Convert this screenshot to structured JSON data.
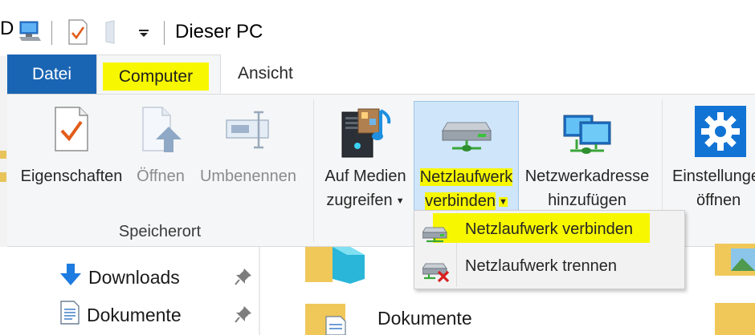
{
  "window": {
    "title": "Dieser PC",
    "partial_left_glyph": "D"
  },
  "quick_access_toolbar": {
    "icons": [
      "computer-icon",
      "properties-checkmark-icon",
      "new-folder-icon",
      "customize-dropdown-icon"
    ]
  },
  "ribbon_tabs": [
    {
      "label": "Datei",
      "state": "file-menu"
    },
    {
      "label": "Computer",
      "state": "active-highlighted"
    },
    {
      "label": "Ansicht",
      "state": "inactive"
    }
  ],
  "ribbon": {
    "group_location_label": "Speicherort",
    "buttons": {
      "properties": {
        "line1": "Eigenschaften",
        "icon": "properties-checkmark-icon"
      },
      "open": {
        "line1": "Öffnen",
        "icon": "open-document-icon",
        "enabled": false
      },
      "rename": {
        "line1": "Umbenennen",
        "icon": "rename-icon",
        "enabled": false
      },
      "access_media": {
        "line1": "Auf Medien",
        "line2": "zugreifen",
        "icon": "media-icon"
      },
      "map_network_drive": {
        "line1": "Netzlaufwerk",
        "line2": "verbinden",
        "icon": "network-drive-icon",
        "state": "pressed-highlighted"
      },
      "add_network_location": {
        "line1": "Netzwerkadresse",
        "line2": "hinzufügen",
        "icon": "network-location-icon"
      },
      "open_settings": {
        "line1": "Einstellungen",
        "line2": "öffnen",
        "icon": "settings-gear-icon"
      }
    }
  },
  "dropdown_menu": {
    "items": [
      {
        "label": "Netzlaufwerk verbinden",
        "icon": "map-drive-icon",
        "highlighted": true
      },
      {
        "label": "Netzlaufwerk trennen",
        "icon": "disconnect-drive-icon",
        "highlighted": false
      }
    ]
  },
  "navigation_pane": {
    "items": [
      {
        "label": "Downloads",
        "icon": "download-arrow-icon",
        "pinned": true
      },
      {
        "label": "Dokumente",
        "icon": "documents-icon",
        "pinned": true
      }
    ]
  },
  "content": {
    "items": [
      {
        "label": "Dokumente",
        "icon": "folder-documents-icon"
      }
    ]
  },
  "colors": {
    "accent_blue": "#1a65b3",
    "highlight_yellow": "#f7f700",
    "ribbon_bg": "#f5f6f7",
    "pressed_button_bg": "#cfe5fa",
    "pressed_button_border": "#9ec6ea",
    "folder_yellow": "#f0c85a",
    "disabled_text": "#8b8b8b"
  }
}
